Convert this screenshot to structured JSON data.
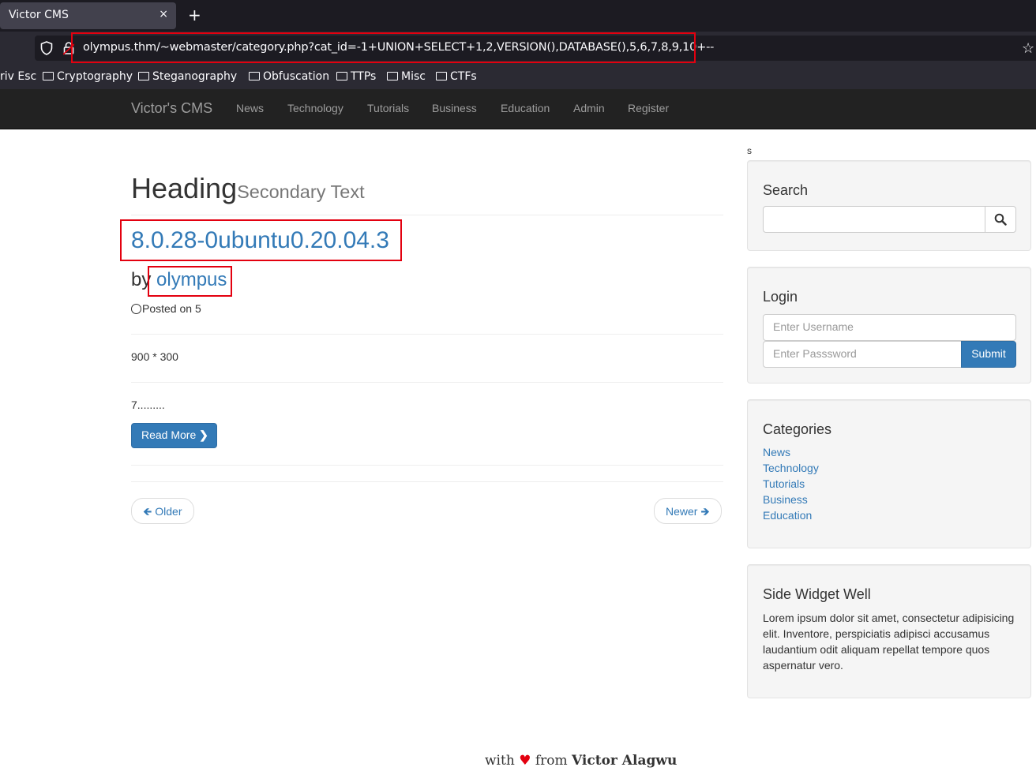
{
  "browser": {
    "tab_title": "Victor CMS",
    "tab_close": "×",
    "new_tab": "+",
    "url": "olympus.thm/~webmaster/category.php?cat_id=-1+UNION+SELECT+1,2,VERSION(),DATABASE(),5,6,7,8,9,10+--",
    "bookmark_partial": "riv Esc",
    "bookmarks": [
      "Cryptography",
      "Steganography",
      "Obfuscation",
      "TTPs",
      "Misc",
      "CTFs"
    ]
  },
  "site_nav": {
    "brand": "Victor's CMS",
    "links": [
      "News",
      "Technology",
      "Tutorials",
      "Business",
      "Education",
      "Admin",
      "Register"
    ]
  },
  "main": {
    "heading": "Heading",
    "heading_secondary": "Secondary Text",
    "post_title": "8.0.28-0ubuntu0.20.04.3",
    "by": "by",
    "author": "olympus",
    "posted": "Posted on 5",
    "image_text": "900 * 300",
    "excerpt": "7.........",
    "read_more": "Read More",
    "older": "Older",
    "newer": "Newer"
  },
  "sidebar": {
    "stray_char": "s",
    "search": {
      "title": "Search"
    },
    "login": {
      "title": "Login",
      "username_placeholder": "Enter Username",
      "password_placeholder": "Enter Passsword",
      "submit": "Submit"
    },
    "categories": {
      "title": "Categories",
      "items": [
        "News",
        "Technology",
        "Tutorials",
        "Business",
        "Education"
      ]
    },
    "widget": {
      "title": "Side Widget Well",
      "text": "Lorem ipsum dolor sit amet, consectetur adipisicing elit. Inventore, perspiciatis adipisci accusamus laudantium odit aliquam repellat tempore quos aspernatur vero."
    }
  },
  "footer": {
    "with": "with",
    "from": "from",
    "author": "Victor Alagwu"
  },
  "colors": {
    "highlight_box": "#e3000f",
    "link": "#337ab7",
    "nav_bg": "#222222"
  }
}
